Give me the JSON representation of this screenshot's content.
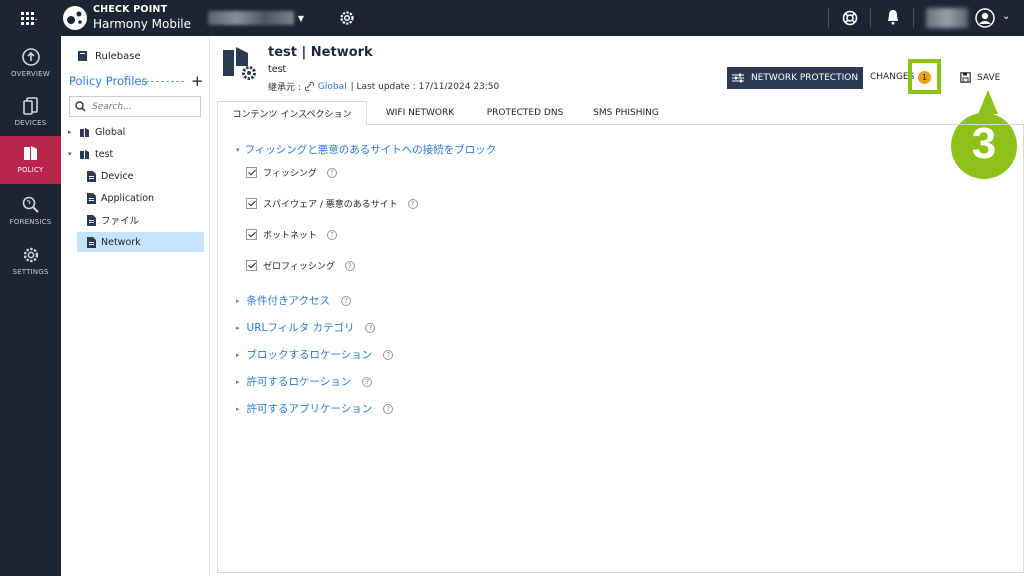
{
  "topbar": {
    "brand_line1": "CHECK POINT",
    "brand_line2": "Harmony Mobile",
    "icons": [
      "apps-grid-icon",
      "check-point-logo",
      "tenant-icon",
      "gear-icon",
      "lifebuoy-icon",
      "bell-icon",
      "avatar-icon"
    ]
  },
  "leftnav": {
    "items": [
      {
        "label": "OVERVIEW",
        "icon": "overview-icon"
      },
      {
        "label": "DEVICES",
        "icon": "devices-icon"
      },
      {
        "label": "POLICY",
        "icon": "policy-icon"
      },
      {
        "label": "FORENSICS",
        "icon": "forensics-icon"
      },
      {
        "label": "SETTINGS",
        "icon": "settings-icon"
      }
    ]
  },
  "tree": {
    "rulebase": "Rulebase",
    "policy_profiles": "Policy Profiles",
    "search_placeholder": "Search...",
    "nodes": [
      "Global",
      "test",
      "Device",
      "Application",
      "ファイル",
      "Network"
    ]
  },
  "header": {
    "title": "test |  Network",
    "subtitle": "test",
    "inherit_label": "継承元 :",
    "inherit_link": "Global",
    "last_update": "| Last update : 17/11/2024 23:50",
    "network_protection_button": "NETWORK PROTECTION",
    "changes_label": "CHANGES",
    "changes_count": "1",
    "save_label": "SAVE",
    "callout_number": "3"
  },
  "tabs": [
    "コンテンツ インスペクション",
    "WIFI NETWORK",
    "PROTECTED DNS",
    "SMS PHISHING"
  ],
  "content": {
    "section_title": "フィッシングと悪意のあるサイトへの接続をブロック",
    "checkboxes": [
      "フィッシング",
      "スパイウェア / 悪意のあるサイト",
      "ボットネット",
      "ゼロフィッシング"
    ],
    "collapsed_sections": [
      "条件付きアクセス",
      "URLフィルタ カテゴリ",
      "ブロックするロケーション",
      "許可するロケーション",
      "許可するアプリケーション"
    ]
  },
  "colors": {
    "topbar_bg": "#1e2532",
    "active_nav": "#b9254b",
    "link_blue": "#2b7bd6",
    "highlight_green": "#8cc217",
    "badge_orange": "#f0a020",
    "button_navy": "#2b3a52"
  }
}
